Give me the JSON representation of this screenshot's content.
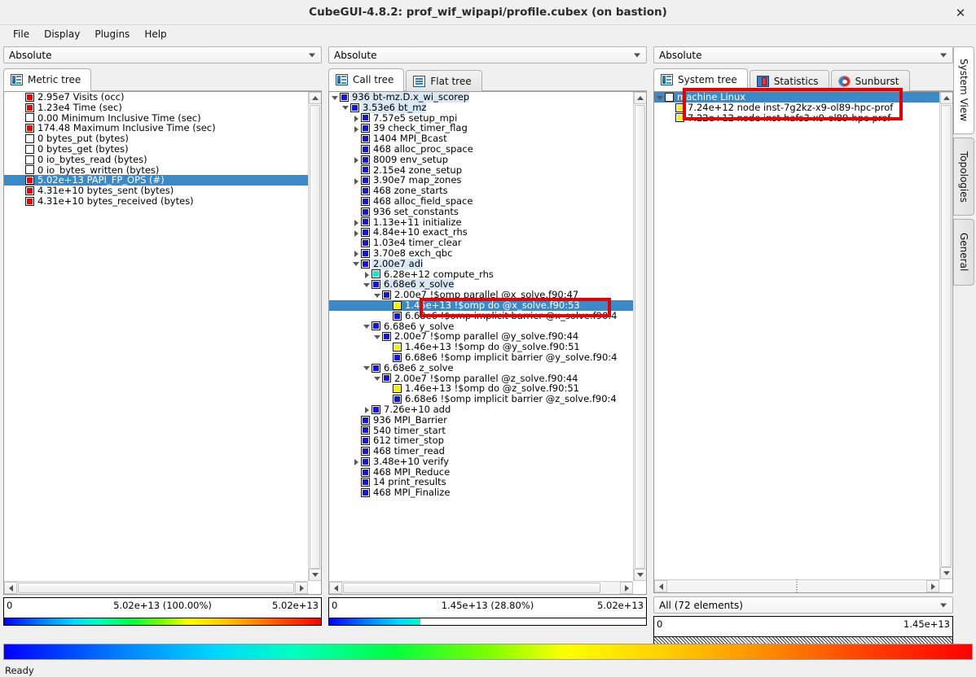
{
  "window": {
    "title": "CubeGUI-4.8.2: prof_wif_wipapi/profile.cubex (on bastion)",
    "close_label": "✕"
  },
  "menu": {
    "items": [
      {
        "label": "File"
      },
      {
        "label": "Display"
      },
      {
        "label": "Plugins"
      },
      {
        "label": "Help"
      }
    ]
  },
  "status": {
    "text": "Ready"
  },
  "side_tabs": [
    {
      "label": "System View",
      "active": true
    },
    {
      "label": "Topologies",
      "active": false
    },
    {
      "label": "General",
      "active": false
    }
  ],
  "metric_panel": {
    "mode": "Absolute",
    "tabs": [
      {
        "label": "Metric tree",
        "icon": "tree-icon",
        "active": true
      }
    ],
    "rows": [
      {
        "indent": 1,
        "expander": "none",
        "square": "red",
        "label": "2.95e7 Visits (occ)",
        "selected": false
      },
      {
        "indent": 1,
        "expander": "none",
        "square": "red",
        "label": "1.23e4 Time (sec)",
        "selected": false
      },
      {
        "indent": 1,
        "expander": "none",
        "square": "white",
        "label": "0.00 Minimum Inclusive Time (sec)",
        "selected": false
      },
      {
        "indent": 1,
        "expander": "none",
        "square": "red",
        "label": "174.48 Maximum Inclusive Time (sec)",
        "selected": false
      },
      {
        "indent": 1,
        "expander": "none",
        "square": "white",
        "label": "0 bytes_put (bytes)",
        "selected": false
      },
      {
        "indent": 1,
        "expander": "none",
        "square": "white",
        "label": "0 bytes_get (bytes)",
        "selected": false
      },
      {
        "indent": 1,
        "expander": "none",
        "square": "white",
        "label": "0 io_bytes_read (bytes)",
        "selected": false
      },
      {
        "indent": 1,
        "expander": "none",
        "square": "white",
        "label": "0 io_bytes_written (bytes)",
        "selected": false
      },
      {
        "indent": 1,
        "expander": "none",
        "square": "red",
        "label": "5.02e+13 PAPI_FP_OPS (#)",
        "selected": true
      },
      {
        "indent": 1,
        "expander": "none",
        "square": "red",
        "label": "4.31e+10 bytes_sent (bytes)",
        "selected": false
      },
      {
        "indent": 1,
        "expander": "none",
        "square": "red",
        "label": "4.31e+10 bytes_received (bytes)",
        "selected": false
      }
    ],
    "value_bar": {
      "min": "0",
      "center": "5.02e+13 (100.00%)",
      "max": "5.02e+13",
      "fill_percent": 100
    }
  },
  "call_panel": {
    "mode": "Absolute",
    "tabs": [
      {
        "label": "Call tree",
        "icon": "tree-icon",
        "active": true
      },
      {
        "label": "Flat tree",
        "icon": "list-icon",
        "active": false
      }
    ],
    "rows": [
      {
        "indent": 0,
        "expander": "open",
        "square": "blue",
        "label": "936 bt-mz.D.x_wi_scorep",
        "tint": true,
        "selected": false
      },
      {
        "indent": 1,
        "expander": "open",
        "square": "blue",
        "label": "3.53e6 bt_mz",
        "tint": true,
        "selected": false
      },
      {
        "indent": 2,
        "expander": "closed",
        "square": "blue",
        "label": "7.57e5 setup_mpi",
        "tint": false,
        "selected": false
      },
      {
        "indent": 2,
        "expander": "closed",
        "square": "blue",
        "label": "39 check_timer_flag",
        "tint": false,
        "selected": false
      },
      {
        "indent": 2,
        "expander": "none",
        "square": "blue",
        "label": "1404 MPI_Bcast",
        "tint": false,
        "selected": false
      },
      {
        "indent": 2,
        "expander": "none",
        "square": "blue",
        "label": "468 alloc_proc_space",
        "tint": false,
        "selected": false
      },
      {
        "indent": 2,
        "expander": "closed",
        "square": "blue",
        "label": "8009 env_setup",
        "tint": false,
        "selected": false
      },
      {
        "indent": 2,
        "expander": "none",
        "square": "blue",
        "label": "2.15e4 zone_setup",
        "tint": false,
        "selected": false
      },
      {
        "indent": 2,
        "expander": "closed",
        "square": "blue",
        "label": "3.90e7 map_zones",
        "tint": false,
        "selected": false
      },
      {
        "indent": 2,
        "expander": "none",
        "square": "blue",
        "label": "468 zone_starts",
        "tint": false,
        "selected": false
      },
      {
        "indent": 2,
        "expander": "none",
        "square": "blue",
        "label": "468 alloc_field_space",
        "tint": false,
        "selected": false
      },
      {
        "indent": 2,
        "expander": "none",
        "square": "blue",
        "label": "936 set_constants",
        "tint": false,
        "selected": false
      },
      {
        "indent": 2,
        "expander": "closed",
        "square": "blue",
        "label": "1.13e+11 initialize",
        "tint": false,
        "selected": false
      },
      {
        "indent": 2,
        "expander": "closed",
        "square": "blue",
        "label": "4.84e+10 exact_rhs",
        "tint": false,
        "selected": false
      },
      {
        "indent": 2,
        "expander": "none",
        "square": "blue",
        "label": "1.03e4 timer_clear",
        "tint": false,
        "selected": false
      },
      {
        "indent": 2,
        "expander": "closed",
        "square": "blue",
        "label": "3.70e8 exch_qbc",
        "tint": false,
        "selected": false
      },
      {
        "indent": 2,
        "expander": "open",
        "square": "blue",
        "label": "2.00e7 adi",
        "tint": true,
        "selected": false
      },
      {
        "indent": 3,
        "expander": "closed",
        "square": "cyan",
        "label": "6.28e+12 compute_rhs",
        "tint": false,
        "selected": false
      },
      {
        "indent": 3,
        "expander": "open",
        "square": "blue",
        "label": "6.68e6 x_solve",
        "tint": true,
        "selected": false
      },
      {
        "indent": 4,
        "expander": "open",
        "square": "blue",
        "label": "2.00e7 !$omp parallel @x_solve.f90:47",
        "tint": false,
        "selected": false
      },
      {
        "indent": 5,
        "expander": "none",
        "square": "yellow",
        "label": "1.45e+13 !$omp do @x_solve.f90:53",
        "tint": false,
        "selected": true
      },
      {
        "indent": 5,
        "expander": "none",
        "square": "blue",
        "label": "6.68e6 !$omp implicit barrier @x_solve.f90:4",
        "tint": false,
        "selected": false
      },
      {
        "indent": 3,
        "expander": "open",
        "square": "blue",
        "label": "6.68e6 y_solve",
        "tint": false,
        "selected": false
      },
      {
        "indent": 4,
        "expander": "open",
        "square": "blue",
        "label": "2.00e7 !$omp parallel @y_solve.f90:44",
        "tint": false,
        "selected": false
      },
      {
        "indent": 5,
        "expander": "none",
        "square": "yellow",
        "label": "1.46e+13 !$omp do @y_solve.f90:51",
        "tint": false,
        "selected": false
      },
      {
        "indent": 5,
        "expander": "none",
        "square": "blue",
        "label": "6.68e6 !$omp implicit barrier @y_solve.f90:4",
        "tint": false,
        "selected": false
      },
      {
        "indent": 3,
        "expander": "open",
        "square": "blue",
        "label": "6.68e6 z_solve",
        "tint": false,
        "selected": false
      },
      {
        "indent": 4,
        "expander": "open",
        "square": "blue",
        "label": "2.00e7 !$omp parallel @z_solve.f90:44",
        "tint": false,
        "selected": false
      },
      {
        "indent": 5,
        "expander": "none",
        "square": "yellow",
        "label": "1.46e+13 !$omp do @z_solve.f90:51",
        "tint": false,
        "selected": false
      },
      {
        "indent": 5,
        "expander": "none",
        "square": "blue",
        "label": "6.68e6 !$omp implicit barrier @z_solve.f90:4",
        "tint": false,
        "selected": false
      },
      {
        "indent": 3,
        "expander": "closed",
        "square": "blue",
        "label": "7.26e+10 add",
        "tint": false,
        "selected": false
      },
      {
        "indent": 2,
        "expander": "none",
        "square": "blue",
        "label": "936 MPI_Barrier",
        "tint": false,
        "selected": false
      },
      {
        "indent": 2,
        "expander": "none",
        "square": "blue",
        "label": "540 timer_start",
        "tint": false,
        "selected": false
      },
      {
        "indent": 2,
        "expander": "none",
        "square": "blue",
        "label": "612 timer_stop",
        "tint": false,
        "selected": false
      },
      {
        "indent": 2,
        "expander": "none",
        "square": "blue",
        "label": "468 timer_read",
        "tint": false,
        "selected": false
      },
      {
        "indent": 2,
        "expander": "closed",
        "square": "blue",
        "label": "3.48e+10 verify",
        "tint": false,
        "selected": false
      },
      {
        "indent": 2,
        "expander": "none",
        "square": "blue",
        "label": "468 MPI_Reduce",
        "tint": false,
        "selected": false
      },
      {
        "indent": 2,
        "expander": "none",
        "square": "blue",
        "label": "14 print_results",
        "tint": false,
        "selected": false
      },
      {
        "indent": 2,
        "expander": "none",
        "square": "blue",
        "label": "468 MPI_Finalize",
        "tint": false,
        "selected": false
      }
    ],
    "value_bar": {
      "min": "0",
      "center": "1.45e+13 (28.80%)",
      "max": "5.02e+13",
      "fill_percent": 28.8
    }
  },
  "system_panel": {
    "mode": "Absolute",
    "tabs": [
      {
        "label": "System tree",
        "icon": "tree-icon",
        "active": true
      },
      {
        "label": "Statistics",
        "icon": "statistics-icon",
        "active": false
      },
      {
        "label": "Sunburst",
        "icon": "sunburst-icon",
        "active": false
      }
    ],
    "rows": [
      {
        "indent": 0,
        "expander": "open",
        "square": "white",
        "label": "machine Linux",
        "selected": true
      },
      {
        "indent": 1,
        "expander": "none",
        "square": "yellow",
        "label": "7.24e+12 node inst-7g2kz-x9-ol89-hpc-prof",
        "selected": false
      },
      {
        "indent": 1,
        "expander": "none",
        "square": "yellow",
        "label": "7.22e+12 node inst-hafs3-x9-ol89-hpc-prof",
        "selected": false
      }
    ],
    "selector": "All (72 elements)",
    "value_bar": {
      "min": "0",
      "center": "",
      "max": "1.45e+13",
      "fill_percent": 0
    }
  },
  "annotations": [
    {
      "name": "call-tree-selection-highlight"
    },
    {
      "name": "system-tree-nodes-highlight"
    }
  ],
  "colors": {
    "selection_blue": "#3a8ac9",
    "annotation_red": "#e60000",
    "tint_blue": "#d9e8f5"
  }
}
